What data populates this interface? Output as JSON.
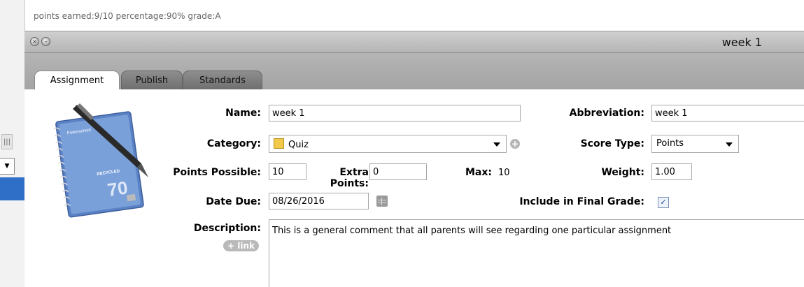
{
  "summary": {
    "text": "points earned:9/10  percentage:90%  grade:A"
  },
  "window": {
    "title": "week 1",
    "close_glyph": "×",
    "min_glyph": "–"
  },
  "tabs": [
    {
      "label": "Assignment",
      "active": true
    },
    {
      "label": "Publish",
      "active": false
    },
    {
      "label": "Standards",
      "active": false
    }
  ],
  "notebook": {
    "icon": "spiral-notebook-pen-icon",
    "brand": "Powerschool",
    "recycled": "RECYCLED",
    "number": "70"
  },
  "form": {
    "name": {
      "label": "Name:",
      "value": "week 1"
    },
    "abbreviation": {
      "label": "Abbreviation:",
      "value": "week 1"
    },
    "category": {
      "label": "Category:",
      "value": "Quiz",
      "icon": "folder-icon"
    },
    "score_type": {
      "label": "Score Type:",
      "value": "Points"
    },
    "points_possible": {
      "label": "Points Possible:",
      "value": "10"
    },
    "extra_points": {
      "label": "Extra Points:",
      "value": "0"
    },
    "max": {
      "label": "Max:",
      "value": "10"
    },
    "weight": {
      "label": "Weight:",
      "value": "1.00"
    },
    "date_due": {
      "label": "Date Due:",
      "value": "08/26/2016"
    },
    "include_final": {
      "label": "Include in Final Grade:",
      "checked": true,
      "glyph": "✓"
    },
    "description": {
      "label": "Description:",
      "value": "This is a general comment that all parents will see regarding one particular assignment",
      "link_label": "+ link"
    }
  },
  "colors": {
    "accent_blue": "#2f6fc8",
    "titlebar": "#c2c2c2"
  }
}
